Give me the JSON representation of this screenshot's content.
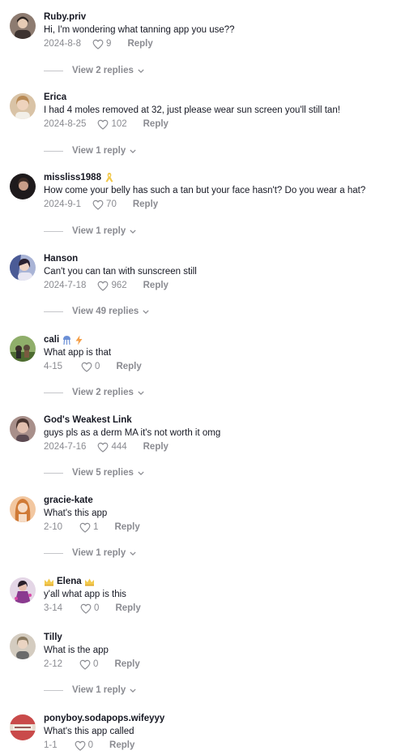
{
  "comments": [
    {
      "username": "Ruby.priv",
      "text": "Hi, I'm wondering what tanning app you use??",
      "date": "2024-8-8",
      "likes": "9",
      "reply": "Reply",
      "view_replies": "View 2 replies",
      "avatar_color": "#7a6a60"
    },
    {
      "username": "Erica",
      "text": "I had 4 moles removed at 32, just please wear sun screen you'll still tan!",
      "date": "2024-8-25",
      "likes": "102",
      "reply": "Reply",
      "view_replies": "View 1 reply",
      "avatar_color": "#c9a27c"
    },
    {
      "username": "missliss1988",
      "text": "How come your belly has such a tan but your face hasn't? Do you wear a hat?",
      "date": "2024-9-1",
      "likes": "70",
      "reply": "Reply",
      "view_replies": "View 1 reply",
      "avatar_color": "#2a2326"
    },
    {
      "username": "Hanson",
      "text": "Can't you can tan with sunscreen still",
      "date": "2024-7-18",
      "likes": "962",
      "reply": "Reply",
      "view_replies": "View 49 replies",
      "avatar_color": "#5a6a9c"
    },
    {
      "username": "cali",
      "text": "What app is that",
      "date": "4-15",
      "likes": "0",
      "reply": "Reply",
      "view_replies": "View 2 replies",
      "avatar_color": "#4b6e3a"
    },
    {
      "username": "God's Weakest Link",
      "text": "guys pls as a derm MA it's not worth it omg",
      "date": "2024-7-16",
      "likes": "444",
      "reply": "Reply",
      "view_replies": "View 5 replies",
      "avatar_color": "#6b5048"
    },
    {
      "username": "gracie-kate",
      "text": "What's this app",
      "date": "2-10",
      "likes": "1",
      "reply": "Reply",
      "view_replies": "View 1 reply",
      "avatar_color": "#d98a4a"
    },
    {
      "username": "Elena",
      "text": "y'all what app is this",
      "date": "3-14",
      "likes": "0",
      "reply": "Reply",
      "view_replies": "",
      "avatar_color": "#7a3a7a"
    },
    {
      "username": "Tilly",
      "text": "What is the app",
      "date": "2-12",
      "likes": "0",
      "reply": "Reply",
      "view_replies": "View 1 reply",
      "avatar_color": "#a89a80"
    },
    {
      "username": "ponyboy.sodapops.wifeyyy",
      "text": "What's this app called",
      "date": "1-1",
      "likes": "0",
      "reply": "Reply",
      "view_replies": "",
      "avatar_color": "#b84a4a"
    }
  ],
  "colors": {
    "text": "#161823",
    "muted": "#8a8b91",
    "accent_ribbon": "#f2c94c",
    "accent_orange": "#f5a04a"
  }
}
